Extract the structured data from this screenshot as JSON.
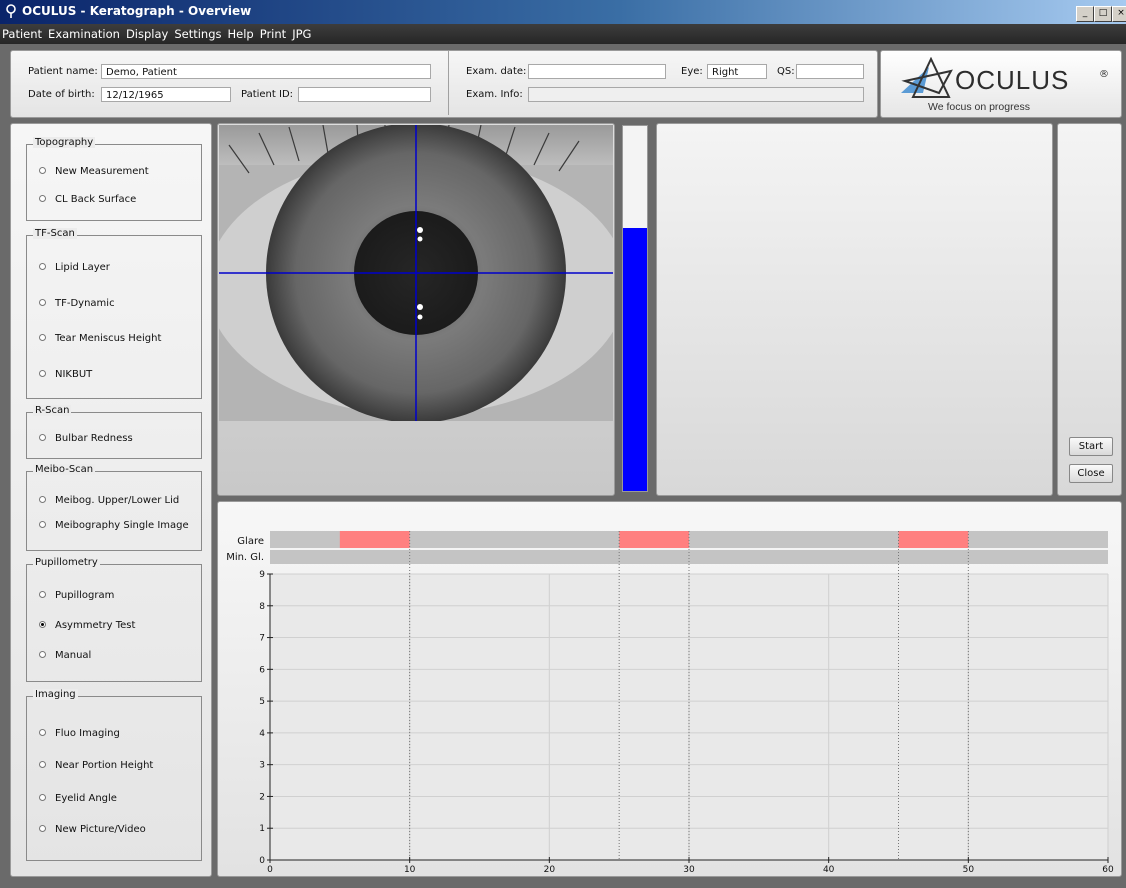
{
  "window": {
    "title": "OCULUS - Keratograph - Overview",
    "controls": [
      "_",
      "□",
      "×"
    ]
  },
  "menu": [
    "Patient",
    "Examination",
    "Display",
    "Settings",
    "Help",
    "Print",
    "JPG"
  ],
  "patient": {
    "name_label": "Patient name:",
    "name_value": "Demo, Patient",
    "dob_label": "Date of birth:",
    "dob_value": "12/12/1965",
    "id_label": "Patient ID:",
    "id_value": ""
  },
  "exam": {
    "date_label": "Exam. date:",
    "date_value": "",
    "eye_label": "Eye:",
    "eye_value": "Right",
    "qs_label": "QS:",
    "qs_value": "",
    "info_label": "Exam. Info:",
    "info_value": ""
  },
  "logo": {
    "brand": "OCULUS",
    "mark": "®",
    "tagline": "We focus on progress"
  },
  "groups": [
    {
      "title": "Topography",
      "items": [
        {
          "label": "New Measurement",
          "checked": false
        },
        {
          "label": "CL Back Surface",
          "checked": false
        }
      ]
    },
    {
      "title": "TF-Scan",
      "items": [
        {
          "label": "Lipid Layer",
          "checked": false
        },
        {
          "label": "TF-Dynamic",
          "checked": false
        },
        {
          "label": "Tear Meniscus Height",
          "checked": false
        },
        {
          "label": "NIKBUT",
          "checked": false
        }
      ]
    },
    {
      "title": "R-Scan",
      "items": [
        {
          "label": "Bulbar Redness",
          "checked": false
        }
      ]
    },
    {
      "title": "Meibo-Scan",
      "items": [
        {
          "label": "Meibog. Upper/Lower Lid",
          "checked": false
        },
        {
          "label": "Meibography Single Image",
          "checked": false
        }
      ]
    },
    {
      "title": "Pupillometry",
      "items": [
        {
          "label": "Pupillogram",
          "checked": false
        },
        {
          "label": "Asymmetry Test",
          "checked": true
        },
        {
          "label": "Manual",
          "checked": false
        }
      ]
    },
    {
      "title": "Imaging",
      "items": [
        {
          "label": "Fluo Imaging",
          "checked": false
        },
        {
          "label": "Near Portion Height",
          "checked": false
        },
        {
          "label": "Eyelid Angle",
          "checked": false
        },
        {
          "label": "New Picture/Video",
          "checked": false
        }
      ]
    }
  ],
  "level_meter": {
    "fill_fraction": 0.72,
    "color": "#0000ff"
  },
  "buttons": {
    "start": "Start",
    "close": "Close"
  },
  "chart_data": {
    "type": "line",
    "glare_label": "Glare",
    "min_glare_label": "Min. Gl.",
    "glare_intervals": [
      [
        5,
        10
      ],
      [
        25,
        30
      ],
      [
        45,
        50
      ]
    ],
    "glare_color": "#ff8080",
    "dotted_markers_x": [
      10,
      25,
      30,
      45,
      50
    ],
    "xlim": [
      0,
      60
    ],
    "ylim": [
      0,
      9
    ],
    "xticks": [
      0,
      10,
      20,
      30,
      40,
      50,
      60
    ],
    "yticks": [
      0,
      1,
      2,
      3,
      4,
      5,
      6,
      7,
      8,
      9
    ],
    "series": []
  }
}
